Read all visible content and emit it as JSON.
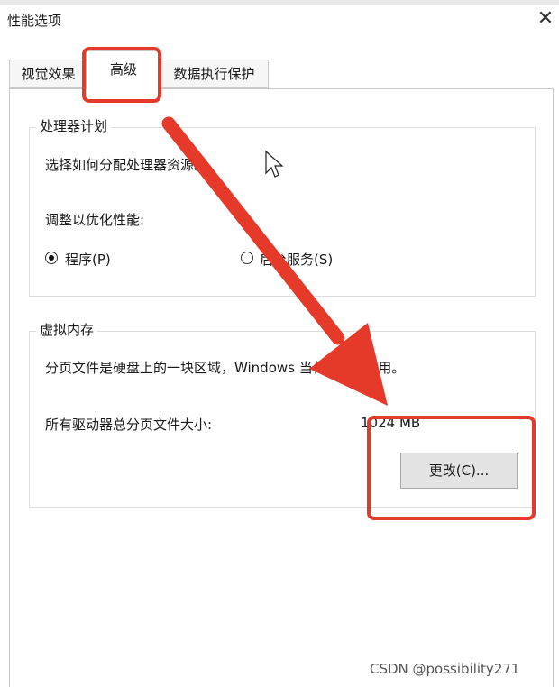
{
  "window": {
    "title": "性能选项",
    "close_glyph": "✕"
  },
  "tabs": [
    {
      "label": "视觉效果"
    },
    {
      "label": "高级"
    },
    {
      "label": "数据执行保护"
    }
  ],
  "processor": {
    "legend": "处理器计划",
    "description": "选择如何分配处理器资源。",
    "prompt": "调整以优化性能:",
    "option_programs": "程序(P)",
    "option_services": "后台服务(S)",
    "selected": "程序(P)"
  },
  "virtual_memory": {
    "legend": "虚拟内存",
    "description": "分页文件是硬盘上的一块区域，Windows 当作 RAM 使用。",
    "total_label": "所有驱动器总分页文件大小:",
    "total_value": "1024 MB",
    "change_button": "更改(C)..."
  },
  "annotation_color": "#e5392a",
  "watermark": "CSDN @possibility271"
}
